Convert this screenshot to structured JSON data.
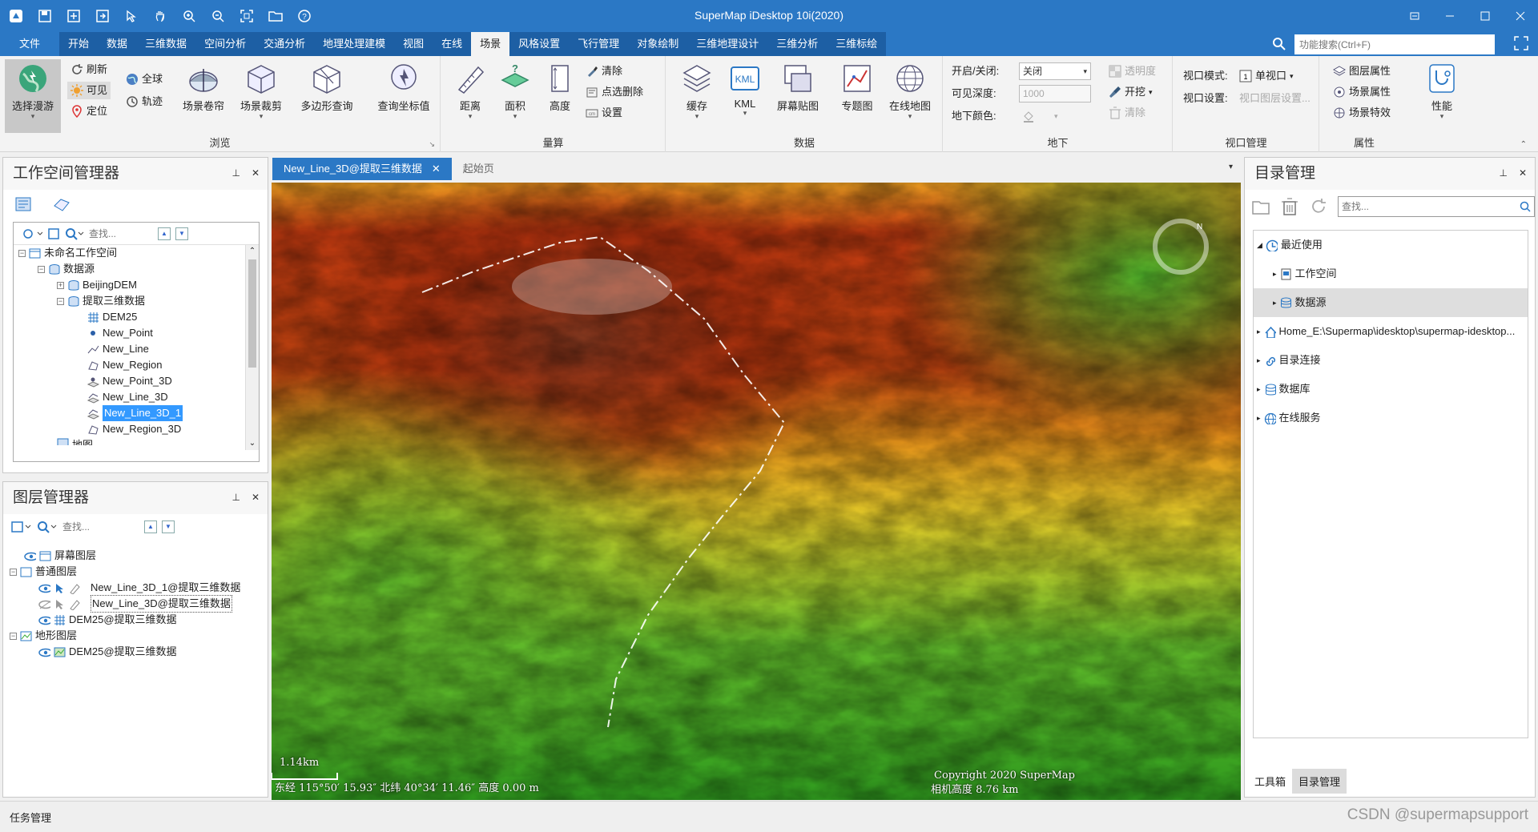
{
  "window": {
    "title": "SuperMap iDesktop 10i(2020)"
  },
  "menu": {
    "tabs": [
      "文件",
      "开始",
      "数据",
      "三维数据",
      "空间分析",
      "交通分析",
      "地理处理建模",
      "视图",
      "在线",
      "场景",
      "风格设置",
      "飞行管理",
      "对象绘制",
      "三维地理设计",
      "三维分析",
      "三维标绘"
    ],
    "active": "场景",
    "search_placeholder": "功能搜索(Ctrl+F)"
  },
  "ribbon": {
    "browse": {
      "label": "浏览",
      "select_roam": "选择漫游",
      "refresh": "刷新",
      "visible": "可见",
      "locate": "定位",
      "global": "全球",
      "track": "轨迹",
      "scene_shutter": "场景卷帘",
      "scene_clip": "场景裁剪",
      "poly_query": "多边形查询",
      "query_coord": "查询坐标值"
    },
    "measure": {
      "label": "量算",
      "distance": "距离",
      "area": "面积",
      "height": "高度",
      "clear": "清除",
      "point_delete": "点选删除",
      "settings": "设置"
    },
    "data": {
      "label": "数据",
      "cache": "缓存",
      "kml": "KML",
      "screen_map": "屏幕贴图",
      "thematic": "专题图",
      "online_map": "在线地图"
    },
    "underground": {
      "label": "地下",
      "on_off_label": "开启/关闭:",
      "on_off_value": "关闭",
      "depth_label": "可见深度:",
      "depth_value": "1000",
      "color_label": "地下颜色:",
      "transparency": "透明度",
      "excavate": "开挖",
      "clear": "清除"
    },
    "viewport": {
      "label": "视口管理",
      "mode_label": "视口模式:",
      "mode_value": "单视口",
      "settings_label": "视口设置:",
      "settings_value": "视口图层设置..."
    },
    "properties": {
      "label": "属性",
      "layer_props": "图层属性",
      "scene_props": "场景属性",
      "scene_effects": "场景特效",
      "performance": "性能"
    }
  },
  "workspace_panel": {
    "title": "工作空间管理器",
    "search_placeholder": "查找...",
    "tree": {
      "root": "未命名工作空间",
      "datasources": "数据源",
      "ds1": "BeijingDEM",
      "ds2": "提取三维数据",
      "items": [
        "DEM25",
        "New_Point",
        "New_Line",
        "New_Region",
        "New_Point_3D",
        "New_Line_3D",
        "New_Line_3D_1",
        "New_Region_3D"
      ],
      "selected": "New_Line_3D_1",
      "map": "地图"
    }
  },
  "layer_panel": {
    "title": "图层管理器",
    "search_placeholder": "查找...",
    "screen_layer": "屏幕图层",
    "normal_layers": "普通图层",
    "layers": [
      "New_Line_3D_1@提取三维数据",
      "New_Line_3D@提取三维数据",
      "DEM25@提取三维数据"
    ],
    "terrain_layers": "地形图层",
    "terrain": [
      "DEM25@提取三维数据"
    ]
  },
  "doc_tabs": {
    "active": "New_Line_3D@提取三维数据",
    "other": "起始页"
  },
  "scene": {
    "scale": "1.14km",
    "copyright": "Copyright 2020 SuperMap",
    "coords": "东经 115°50′ 15.93″  北纬 40°34′ 11.46″  高度 0.00 m",
    "camera": "相机高度 8.76 km",
    "compass": "N"
  },
  "catalog_panel": {
    "title": "目录管理",
    "search_placeholder": "查找...",
    "recent": "最近使用",
    "workspace": "工作空间",
    "datasource": "数据源",
    "home": "Home_E:\\Supermap\\idesktop\\supermap-idesktop...",
    "dir_conn": "目录连接",
    "database": "数据库",
    "online_service": "在线服务",
    "bottom_tabs": [
      "工具箱",
      "目录管理"
    ]
  },
  "status": {
    "task": "任务管理",
    "watermark": "CSDN @supermapsupport"
  },
  "colors": {
    "title_blue": "#2b78c5",
    "selection": "#3399ff"
  }
}
